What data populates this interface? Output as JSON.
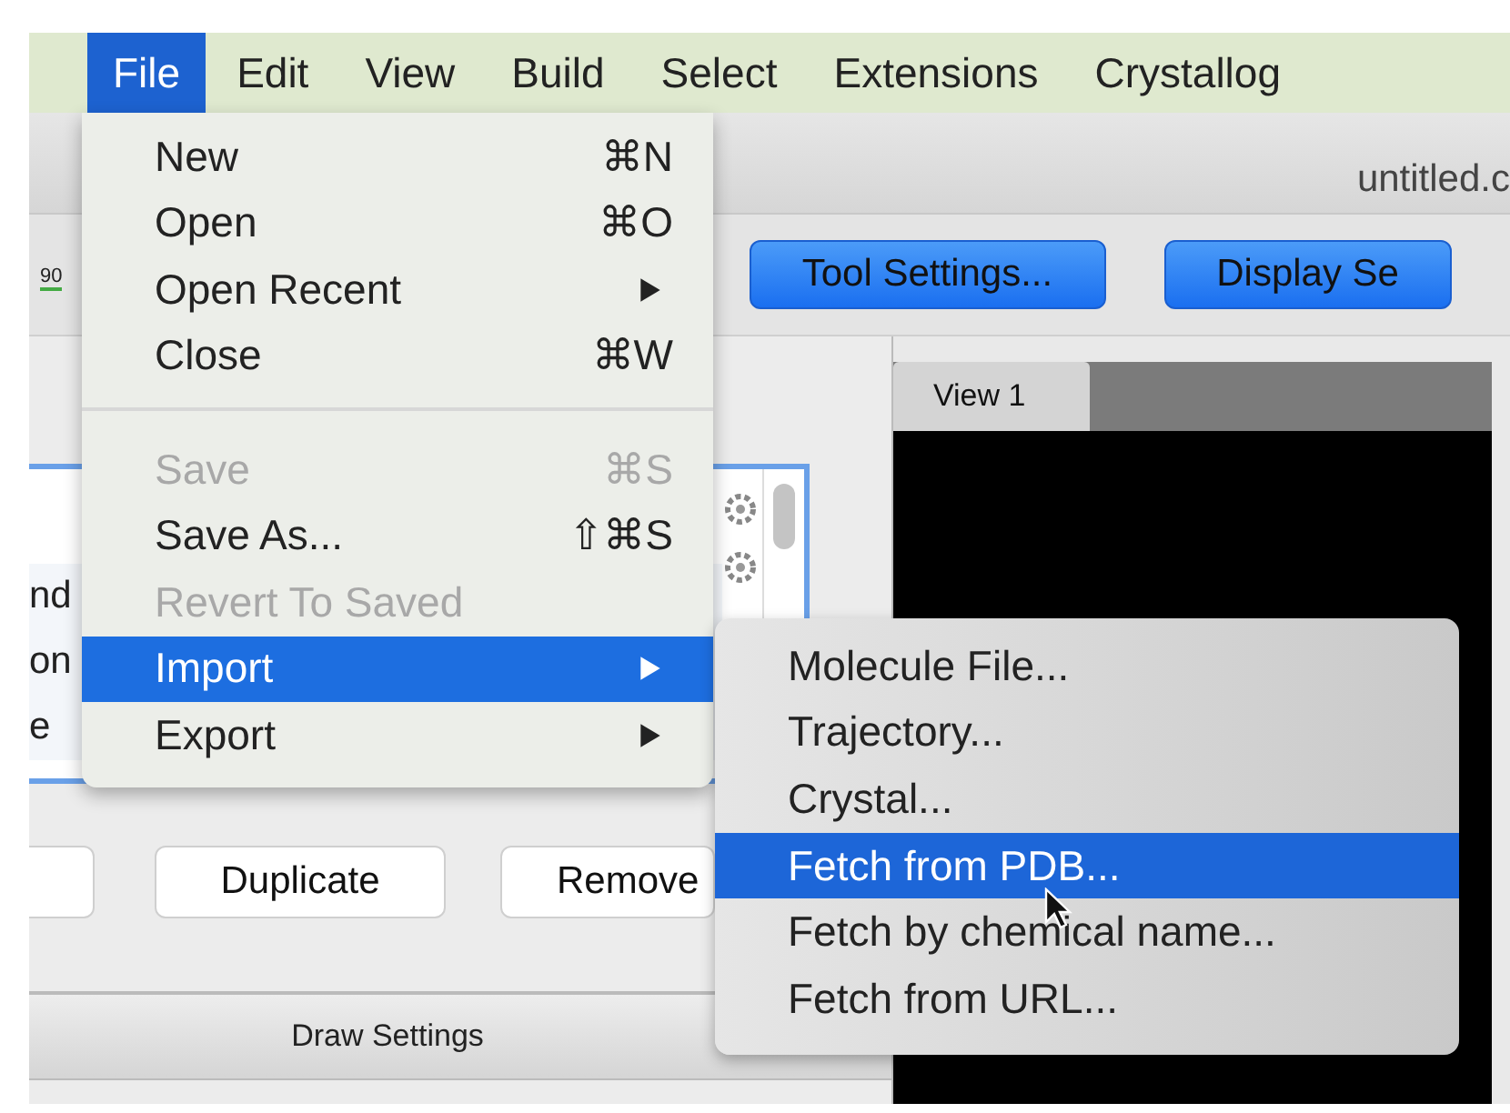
{
  "menubar": {
    "items": [
      {
        "label": "File",
        "selected": true
      },
      {
        "label": "Edit",
        "selected": false
      },
      {
        "label": "View",
        "selected": false
      },
      {
        "label": "Build",
        "selected": false
      },
      {
        "label": "Select",
        "selected": false
      },
      {
        "label": "Extensions",
        "selected": false
      },
      {
        "label": "Crystallog",
        "selected": false
      }
    ]
  },
  "window": {
    "title": "untitled.c"
  },
  "toolbar": {
    "ruler_label": "90",
    "buttons": [
      "Tool Settings...",
      "Display Se"
    ]
  },
  "left_panel": {
    "list_rows": [
      "nd",
      "on",
      "e"
    ],
    "buttons": [
      "Duplicate",
      "Remove"
    ],
    "footer": "Draw Settings"
  },
  "view_tabs": [
    {
      "label": "View 1",
      "selected": true
    }
  ],
  "file_menu": [
    {
      "kind": "item",
      "label": "New",
      "shortcut": "⌘N",
      "disabled": false,
      "selected": false,
      "submenu": false
    },
    {
      "kind": "item",
      "label": "Open",
      "shortcut": "⌘O",
      "disabled": false,
      "selected": false,
      "submenu": false
    },
    {
      "kind": "item",
      "label": "Open Recent",
      "disabled": false,
      "selected": false,
      "submenu": true
    },
    {
      "kind": "item",
      "label": "Close",
      "shortcut": "⌘W",
      "disabled": false,
      "selected": false,
      "submenu": false
    },
    {
      "kind": "separator"
    },
    {
      "kind": "item",
      "label": "Save",
      "shortcut": "⌘S",
      "disabled": true,
      "selected": false,
      "submenu": false
    },
    {
      "kind": "item",
      "label": "Save As...",
      "shortcut": "⇧⌘S",
      "disabled": false,
      "selected": false,
      "submenu": false
    },
    {
      "kind": "item",
      "label": "Revert To Saved",
      "disabled": true,
      "selected": false,
      "submenu": false
    },
    {
      "kind": "item",
      "label": "Import",
      "disabled": false,
      "selected": true,
      "submenu": true
    },
    {
      "kind": "item",
      "label": "Export",
      "disabled": false,
      "selected": false,
      "submenu": true
    }
  ],
  "import_submenu": [
    {
      "label": "Molecule File...",
      "selected": false
    },
    {
      "label": "Trajectory...",
      "selected": false
    },
    {
      "label": "Crystal...",
      "selected": false
    },
    {
      "label": "Fetch from PDB...",
      "selected": true
    },
    {
      "label": "Fetch by chemical name...",
      "selected": false
    },
    {
      "label": "Fetch from URL...",
      "selected": false
    }
  ]
}
